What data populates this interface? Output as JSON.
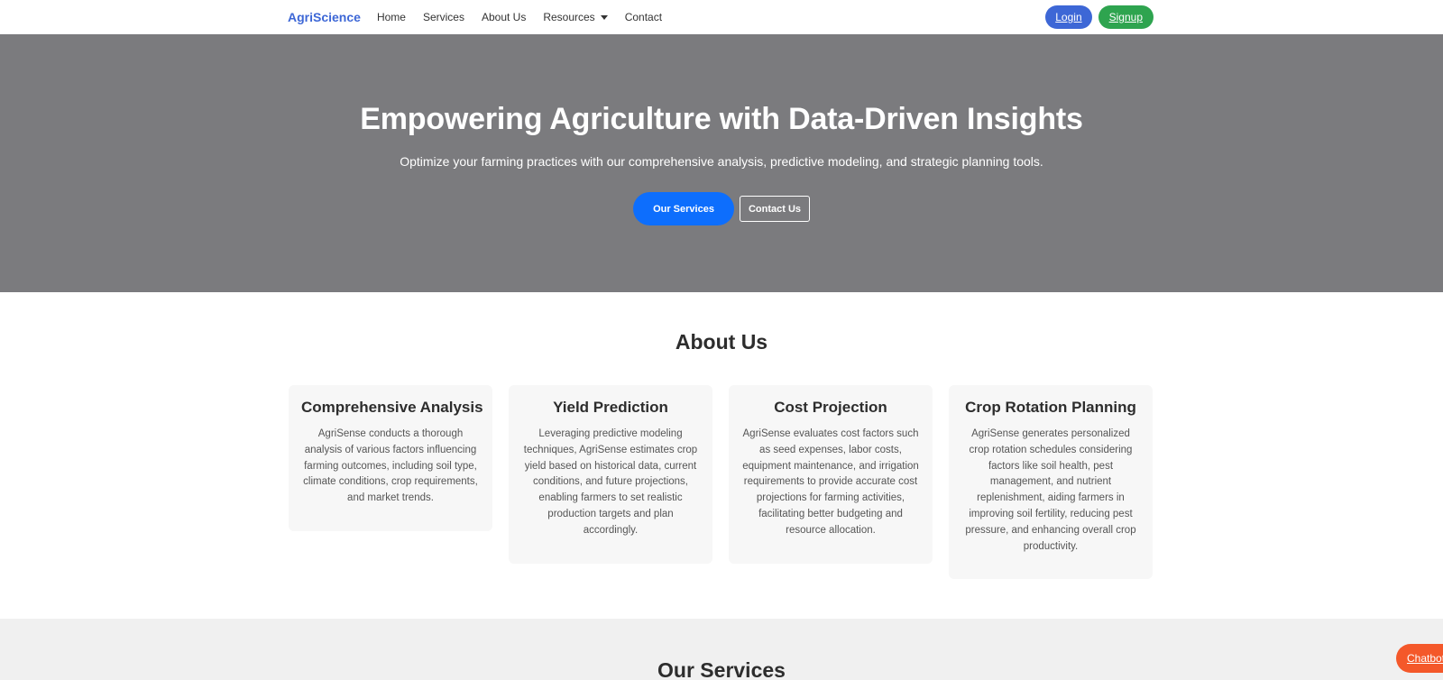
{
  "nav": {
    "brand": "AgriScience",
    "links": [
      "Home",
      "Services",
      "About Us",
      "Resources",
      "Contact"
    ],
    "login": "Login",
    "signup": "Signup"
  },
  "hero": {
    "title": "Empowering Agriculture with Data-Driven Insights",
    "subtitle": "Optimize your farming practices with our comprehensive analysis, predictive modeling, and strategic planning tools.",
    "primary_button": "Our Services",
    "secondary_button": "Contact Us"
  },
  "about": {
    "title": "About Us",
    "cards": [
      {
        "title": "Comprehensive Analysis",
        "text": "AgriSense conducts a thorough analysis of various factors influencing farming outcomes, including soil type, climate conditions, crop requirements, and market trends."
      },
      {
        "title": "Yield Prediction",
        "text": "Leveraging predictive modeling techniques, AgriSense estimates crop yield based on historical data, current conditions, and future projections, enabling farmers to set realistic production targets and plan accordingly."
      },
      {
        "title": "Cost Projection",
        "text": "AgriSense evaluates cost factors such as seed expenses, labor costs, equipment maintenance, and irrigation requirements to provide accurate cost projections for farming activities, facilitating better budgeting and resource allocation."
      },
      {
        "title": "Crop Rotation Planning",
        "text": "AgriSense generates personalized crop rotation schedules considering factors like soil health, pest management, and nutrient replenishment, aiding farmers in improving soil fertility, reducing pest pressure, and enhancing overall crop productivity."
      }
    ]
  },
  "services": {
    "title": "Our Services"
  },
  "chatbot": {
    "label": "Chatbot"
  },
  "colors": {
    "brand": "#3d67d6",
    "login_bg": "#3d67d6",
    "signup_bg": "#2ea44f",
    "hero_bg": "#7b7b7e",
    "primary_button_bg": "#0d6efd",
    "chatbot_bg": "#f4582a"
  }
}
